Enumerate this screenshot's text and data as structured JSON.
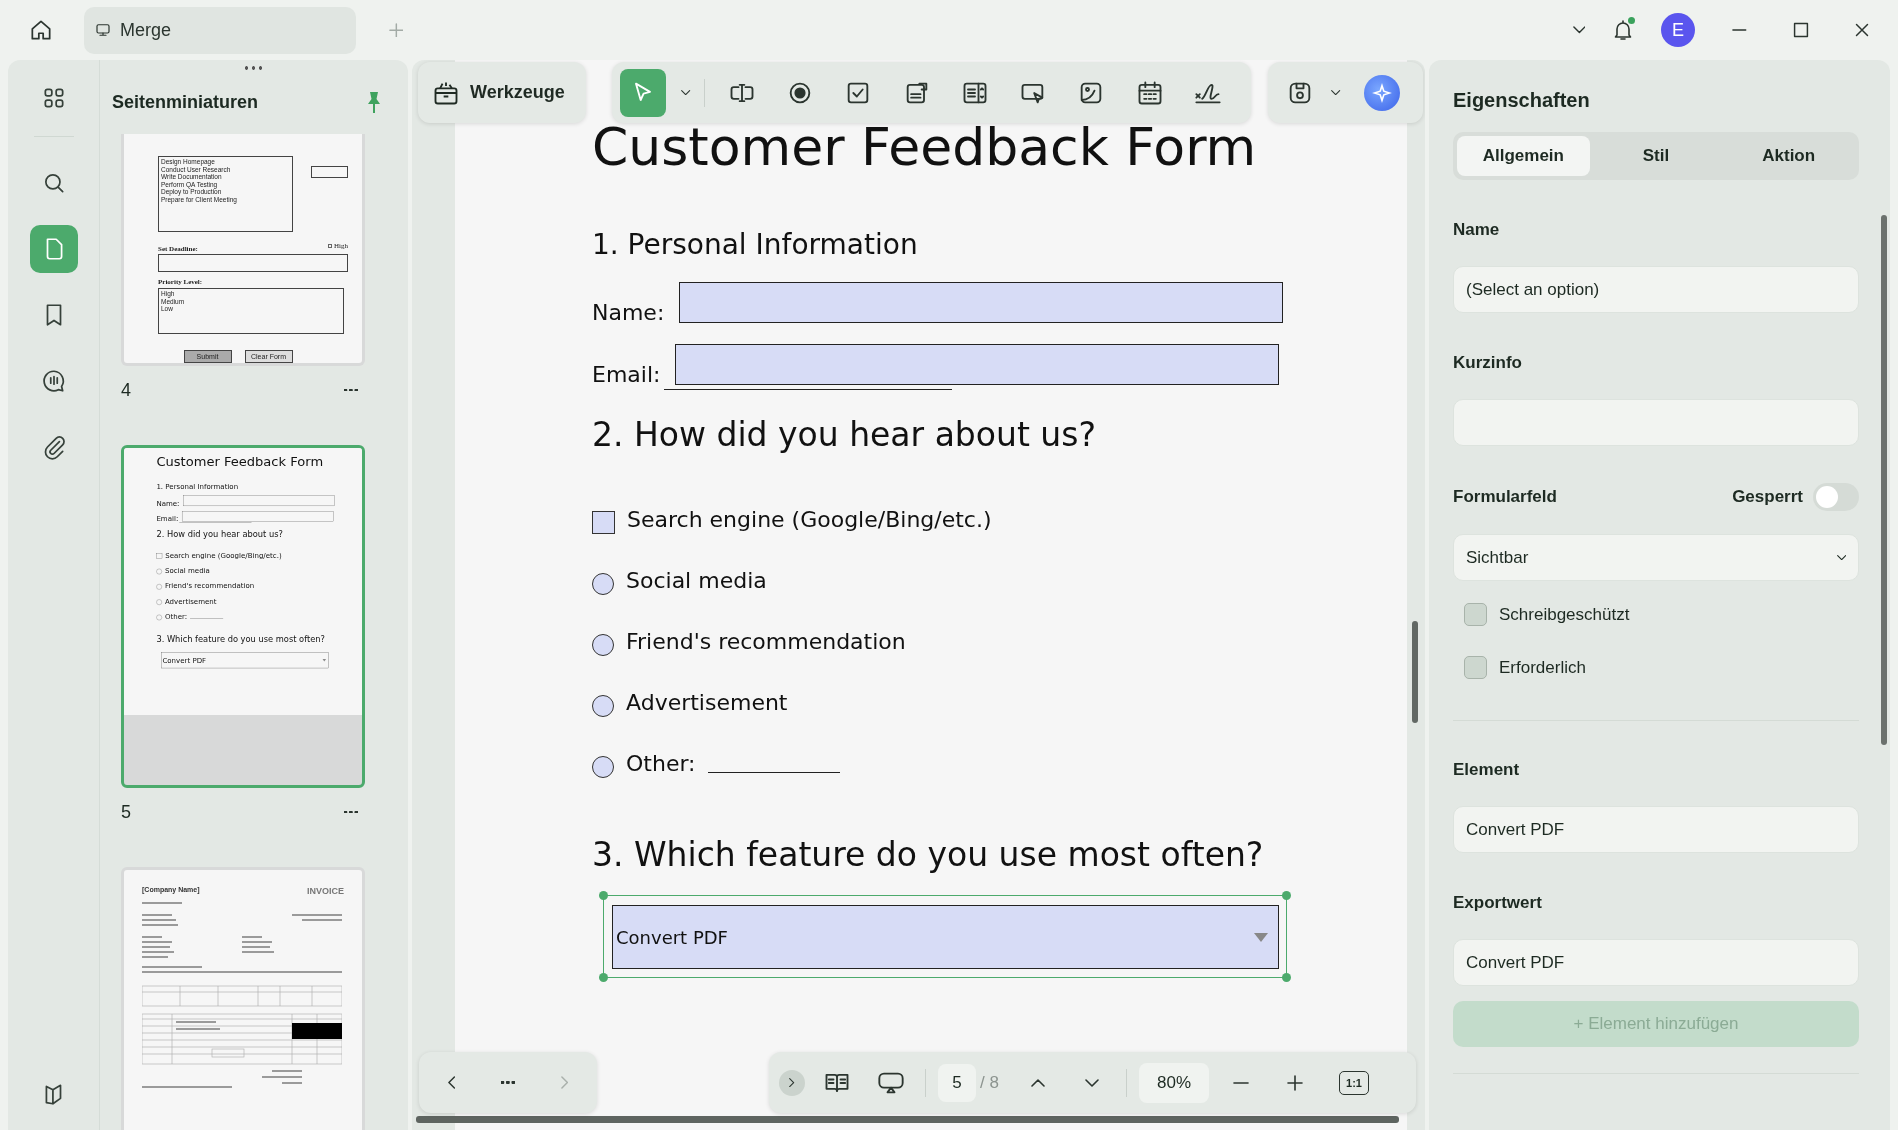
{
  "title_bar": {
    "tabs": [
      {
        "label": "Merge",
        "selected": true
      }
    ],
    "avatar": "E",
    "notification_dot": true
  },
  "rail": {
    "items": [
      {
        "kind": "apps",
        "selected": false
      },
      {
        "kind": "search",
        "selected": false
      },
      {
        "kind": "page",
        "selected": true
      },
      {
        "kind": "bookmark",
        "selected": false
      },
      {
        "kind": "comment",
        "selected": false
      },
      {
        "kind": "paperclip",
        "selected": false
      }
    ]
  },
  "thumbnails": {
    "title": "Seitenminiaturen",
    "pinned": true,
    "pages": [
      {
        "label": "4",
        "selected": false,
        "content": {
          "kind": "task_form",
          "tasks": [
            "Design Homepage",
            "Conduct User Research",
            "Write Documentation",
            "Perform QA Testing",
            "Deploy to Production",
            "Prepare for Client Meeting"
          ],
          "deadline_label": "Set Deadline:",
          "high_label": "High",
          "priority_label": "Priority Level:",
          "priorities": [
            "High",
            "Medium",
            "Low"
          ],
          "buttons": [
            "Submit",
            "Clear Form"
          ]
        }
      },
      {
        "label": "5",
        "selected": true,
        "content": {
          "kind": "feedback_form",
          "title": "Customer Feedback Form",
          "highlighted": false,
          "sections": [
            {
              "heading": "1. Personal Information",
              "fields": [
                {
                  "kind": "text",
                  "label": "Name:",
                  "underline": false
                },
                {
                  "kind": "text",
                  "label": "Email:",
                  "underline": true
                }
              ]
            },
            {
              "heading": "2. How did you hear about us?",
              "fields": [
                {
                  "kind": "checkbox",
                  "label": "Search engine (Google/Bing/etc.)",
                  "checked": false
                },
                {
                  "kind": "radio",
                  "label": "Social media",
                  "selected": false
                },
                {
                  "kind": "radio",
                  "label": "Friend's recommendation",
                  "selected": false
                },
                {
                  "kind": "radio",
                  "label": "Advertisement",
                  "selected": false
                },
                {
                  "kind": "radio",
                  "label": "Other:",
                  "selected": false,
                  "fill_in": true
                }
              ]
            },
            {
              "heading": "3. Which feature do you use most often?",
              "fields": [
                {
                  "kind": "dropdown",
                  "value": "Convert PDF",
                  "selected": false
                }
              ]
            }
          ]
        }
      },
      {
        "selected": false,
        "content": {
          "kind": "invoice",
          "company": "[Company Name]",
          "title": "INVOICE"
        }
      }
    ]
  },
  "toolbar": {
    "tools_button": "Werkzeuge",
    "tools": [
      {
        "kind": "select",
        "selected": true
      },
      {
        "kind": "textfield",
        "selected": false
      },
      {
        "kind": "radio",
        "selected": false
      },
      {
        "kind": "checkbox",
        "selected": false
      },
      {
        "kind": "combobox",
        "selected": false
      },
      {
        "kind": "listbox",
        "selected": false
      },
      {
        "kind": "button",
        "selected": false
      },
      {
        "kind": "image",
        "selected": false
      },
      {
        "kind": "date",
        "selected": false
      },
      {
        "kind": "signature",
        "selected": false
      }
    ]
  },
  "document": {
    "kind": "feedback_form",
    "title": "Customer Feedback Form",
    "highlighted": true,
    "sections": [
      {
        "heading": "1. Personal Information",
        "fields": [
          {
            "kind": "text",
            "label": "Name:",
            "underline": false
          },
          {
            "kind": "text",
            "label": "Email:",
            "underline": true
          }
        ]
      },
      {
        "heading": "2. How did you hear about us?",
        "fields": [
          {
            "kind": "checkbox",
            "label": "Search engine (Google/Bing/etc.)",
            "checked": false
          },
          {
            "kind": "radio",
            "label": "Social media",
            "selected": false
          },
          {
            "kind": "radio",
            "label": "Friend's recommendation",
            "selected": false
          },
          {
            "kind": "radio",
            "label": "Advertisement",
            "selected": false
          },
          {
            "kind": "radio",
            "label": "Other:",
            "selected": false,
            "fill_in": true
          }
        ]
      },
      {
        "heading": "3. Which feature do you use most often?",
        "fields": [
          {
            "kind": "dropdown",
            "value": "Convert PDF",
            "selected": true
          }
        ]
      }
    ]
  },
  "bottom_bar": {
    "next_disabled": true,
    "page": "5",
    "page_count": "/ 8",
    "zoom": "80%",
    "actual_size": "1:1"
  },
  "properties": {
    "title": "Eigenschaften",
    "tabs": [
      {
        "label": "Allgemein",
        "selected": true
      },
      {
        "label": "Stil",
        "selected": false
      },
      {
        "label": "Aktion",
        "selected": false
      }
    ],
    "name": {
      "label": "Name",
      "value": "(Select an option)"
    },
    "tooltip": {
      "label": "Kurzinfo"
    },
    "form_field": {
      "label": "Formularfeld",
      "lock_label": "Gesperrt",
      "locked": false,
      "visibility": "Sichtbar",
      "options": [
        {
          "label": "Schreibgeschützt",
          "checked": false
        },
        {
          "label": "Erforderlich",
          "checked": false
        }
      ]
    },
    "item": {
      "label": "Element",
      "value": "Convert PDF"
    },
    "export_value": {
      "label": "Exportwert",
      "value": "Convert PDF"
    },
    "add_button": {
      "label": "+ Element hinzufügen",
      "disabled": true
    }
  }
}
